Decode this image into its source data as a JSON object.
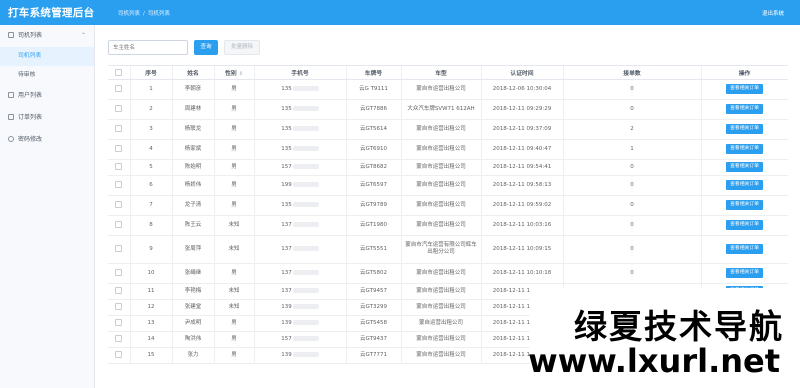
{
  "app": {
    "title": "打车系统管理后台",
    "breadcrumb": [
      "司机列表",
      "司机列表"
    ],
    "breadcrumb_sep": "/",
    "logout": "退出系统",
    "accent": "#2a9ff0"
  },
  "sidebar": {
    "groups": [
      {
        "label": "司机列表",
        "icon": "folder-icon",
        "expanded": true,
        "items": [
          {
            "label": "司机列表",
            "active": true
          },
          {
            "label": "待审核",
            "active": false
          }
        ]
      },
      {
        "label": "用户列表",
        "icon": "grid-icon"
      },
      {
        "label": "订单列表",
        "icon": "grid-icon"
      },
      {
        "label": "密码修改",
        "icon": "settings-icon"
      }
    ]
  },
  "toolbar": {
    "search_placeholder": "车主姓名",
    "query_label": "查询",
    "batch_delete_label": "批量删除"
  },
  "table": {
    "columns": [
      "序号",
      "姓名",
      "性别",
      "手机号",
      "车牌号",
      "车型",
      "认证时间",
      "接单数",
      "操作"
    ],
    "gender_sort_icon": "sort-icon",
    "action_label": "查看相关订单",
    "rows": [
      {
        "no": "1",
        "name": "李朝彦",
        "gender": "男",
        "phone": "135",
        "plate": "云G T9111",
        "model": "蒙自市运营出租公司",
        "time": "2018-12-06 10:30:04",
        "orders": "0"
      },
      {
        "no": "2",
        "name": "周建林",
        "gender": "男",
        "phone": "135",
        "plate": "云GT7886",
        "model": "大众汽车牌SVW71 612AH",
        "time": "2018-12-11 09:29:29",
        "orders": "0"
      },
      {
        "no": "3",
        "name": "杨联龙",
        "gender": "男",
        "phone": "135",
        "plate": "云GT5614",
        "model": "蒙自市运营出租公司",
        "time": "2018-12-11 09:37:09",
        "orders": "2"
      },
      {
        "no": "4",
        "name": "杨家斌",
        "gender": "男",
        "phone": "135",
        "plate": "云GT6910",
        "model": "蒙自市运营出租公司",
        "time": "2018-12-11 09:40:47",
        "orders": "1"
      },
      {
        "no": "5",
        "name": "陈始明",
        "gender": "男",
        "phone": "157",
        "plate": "云GT8682",
        "model": "蒙自市运营出租公司",
        "time": "2018-12-11 09:54:41",
        "orders": "0"
      },
      {
        "no": "6",
        "name": "杨娇伟",
        "gender": "男",
        "phone": "199",
        "plate": "云GT6597",
        "model": "蒙自市运营出租公司",
        "time": "2018-12-11 09:58:13",
        "orders": "0"
      },
      {
        "no": "7",
        "name": "龙子清",
        "gender": "男",
        "phone": "135",
        "plate": "云GT9789",
        "model": "蒙自市运营出租公司",
        "time": "2018-12-11 09:59:02",
        "orders": "0"
      },
      {
        "no": "8",
        "name": "陈王云",
        "gender": "未知",
        "phone": "137",
        "plate": "云GT1980",
        "model": "蒙自市运营出租公司",
        "time": "2018-12-11 10:03:16",
        "orders": "0"
      },
      {
        "no": "9",
        "name": "张周萍",
        "gender": "未知",
        "phone": "137",
        "plate": "云GT5551",
        "model": "蒙自市汽车运营有限公司辉车出租分公司",
        "time": "2018-12-11 10:09:15",
        "orders": "0"
      },
      {
        "no": "10",
        "name": "张绳继",
        "gender": "男",
        "phone": "137",
        "plate": "云GT5802",
        "model": "蒙自市运营出租公司",
        "time": "2018-12-11 10:10:18",
        "orders": "0"
      },
      {
        "no": "11",
        "name": "李艳梅",
        "gender": "未知",
        "phone": "137",
        "plate": "云GT9457",
        "model": "蒙自市运营出租公司",
        "time": "2018-12-11 10:18:01",
        "orders": "0"
      },
      {
        "no": "12",
        "name": "张建堂",
        "gender": "未知",
        "phone": "139",
        "plate": "云GT3299",
        "model": "蒙自市运营出租公司",
        "time": "2018-12-11 10:54:39",
        "orders": "0"
      },
      {
        "no": "13",
        "name": "尹成明",
        "gender": "男",
        "phone": "139",
        "plate": "云GT5458",
        "model": "蒙自运营出租公司",
        "time": "2018-12-11 10:56:04",
        "orders": "0"
      },
      {
        "no": "14",
        "name": "陶洪伟",
        "gender": "男",
        "phone": "157",
        "plate": "云GT9437",
        "model": "蒙自市运营出租公司",
        "time": "2018-12-11 11:05:32",
        "orders": "0"
      },
      {
        "no": "15",
        "name": "张力",
        "gender": "男",
        "phone": "139",
        "plate": "云GT7771",
        "model": "蒙自市运营出租公司",
        "time": "2018-12-11 11:14:32",
        "orders": "0"
      }
    ]
  },
  "watermark": {
    "line1": "绿夏技术导航",
    "line2": "www.lxurl.net"
  }
}
